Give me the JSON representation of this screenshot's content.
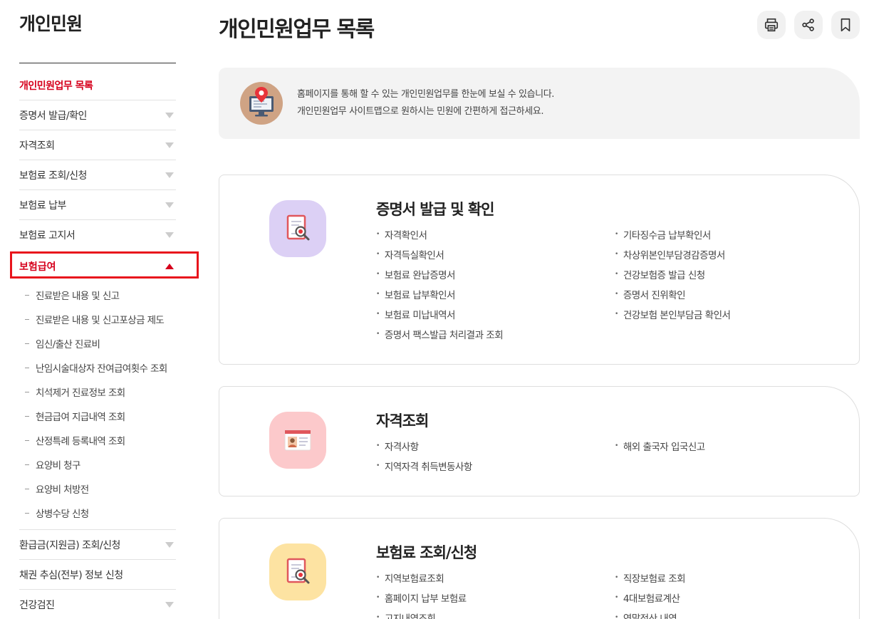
{
  "sidebar": {
    "title": "개인민원",
    "items_top": [
      {
        "label": "개인민원업무 목록",
        "active": true
      },
      {
        "label": "증명서 발급/확인"
      },
      {
        "label": "자격조회"
      },
      {
        "label": "보험료 조회/신청"
      },
      {
        "label": "보험료 납부"
      },
      {
        "label": "보험료 고지서"
      }
    ],
    "open_item": {
      "label": "보험급여"
    },
    "sub_items": [
      {
        "label": "진료받은 내용 및 신고"
      },
      {
        "label": "진료받은 내용 및 신고포상금 제도"
      },
      {
        "label": "임신/출산 진료비"
      },
      {
        "label": "난임시술대상자 잔여급여횟수 조회"
      },
      {
        "label": "치석제거 진료정보 조회"
      },
      {
        "label": "현금급여 지급내역 조회"
      },
      {
        "label": "산정특례 등록내역 조회"
      },
      {
        "label": "요양비 청구"
      },
      {
        "label": "요양비 처방전"
      },
      {
        "label": "상병수당 신청"
      }
    ],
    "items_bottom": [
      {
        "label": "환급금(지원금) 조회/신청"
      },
      {
        "label": "채권 추심(전부) 정보 신청"
      },
      {
        "label": "건강검진"
      }
    ]
  },
  "header": {
    "title": "개인민원업무 목록",
    "buttons": [
      "print-icon",
      "share-icon",
      "bookmark-icon"
    ]
  },
  "info": {
    "line1": "홈페이지를 통해 할 수 있는 개인민원업무를 한눈에 보실 수 있습니다.",
    "line2": "개인민원업무 사이트맵으로 원하시는 민원에 간편하게 접근하세요."
  },
  "cards": [
    {
      "title": "증명서 발급 및 확인",
      "icon": "document-search-icon",
      "color": "#dcd0f5",
      "items": [
        "자격확인서",
        "기타징수금 납부확인서",
        "자격득실확인서",
        "차상위본인부담경감증명서",
        "보험료 완납증명서",
        "건강보험증 발급 신청",
        "보험료 납부확인서",
        "증명서 진위확인",
        "보험료 미납내역서",
        "건강보험 본인부담금 확인서",
        "증명서 팩스발급 처리결과 조회"
      ]
    },
    {
      "title": "자격조회",
      "icon": "id-card-icon",
      "color": "#fcc9cb",
      "items": [
        "자격사항",
        "해외 출국자 입국신고",
        "지역자격 취득변동사항"
      ]
    },
    {
      "title": "보험료 조회/신청",
      "icon": "document-search-icon",
      "color": "#fde3a2",
      "items": [
        "지역보험료조회",
        "직장보험료 조회",
        "홈페이지 납부 보험료",
        "4대보험료계산",
        "고지내역조회",
        "연말정산 내역"
      ]
    }
  ],
  "colors": {
    "accent": "#d6001c",
    "highlight": "#e8141c"
  }
}
